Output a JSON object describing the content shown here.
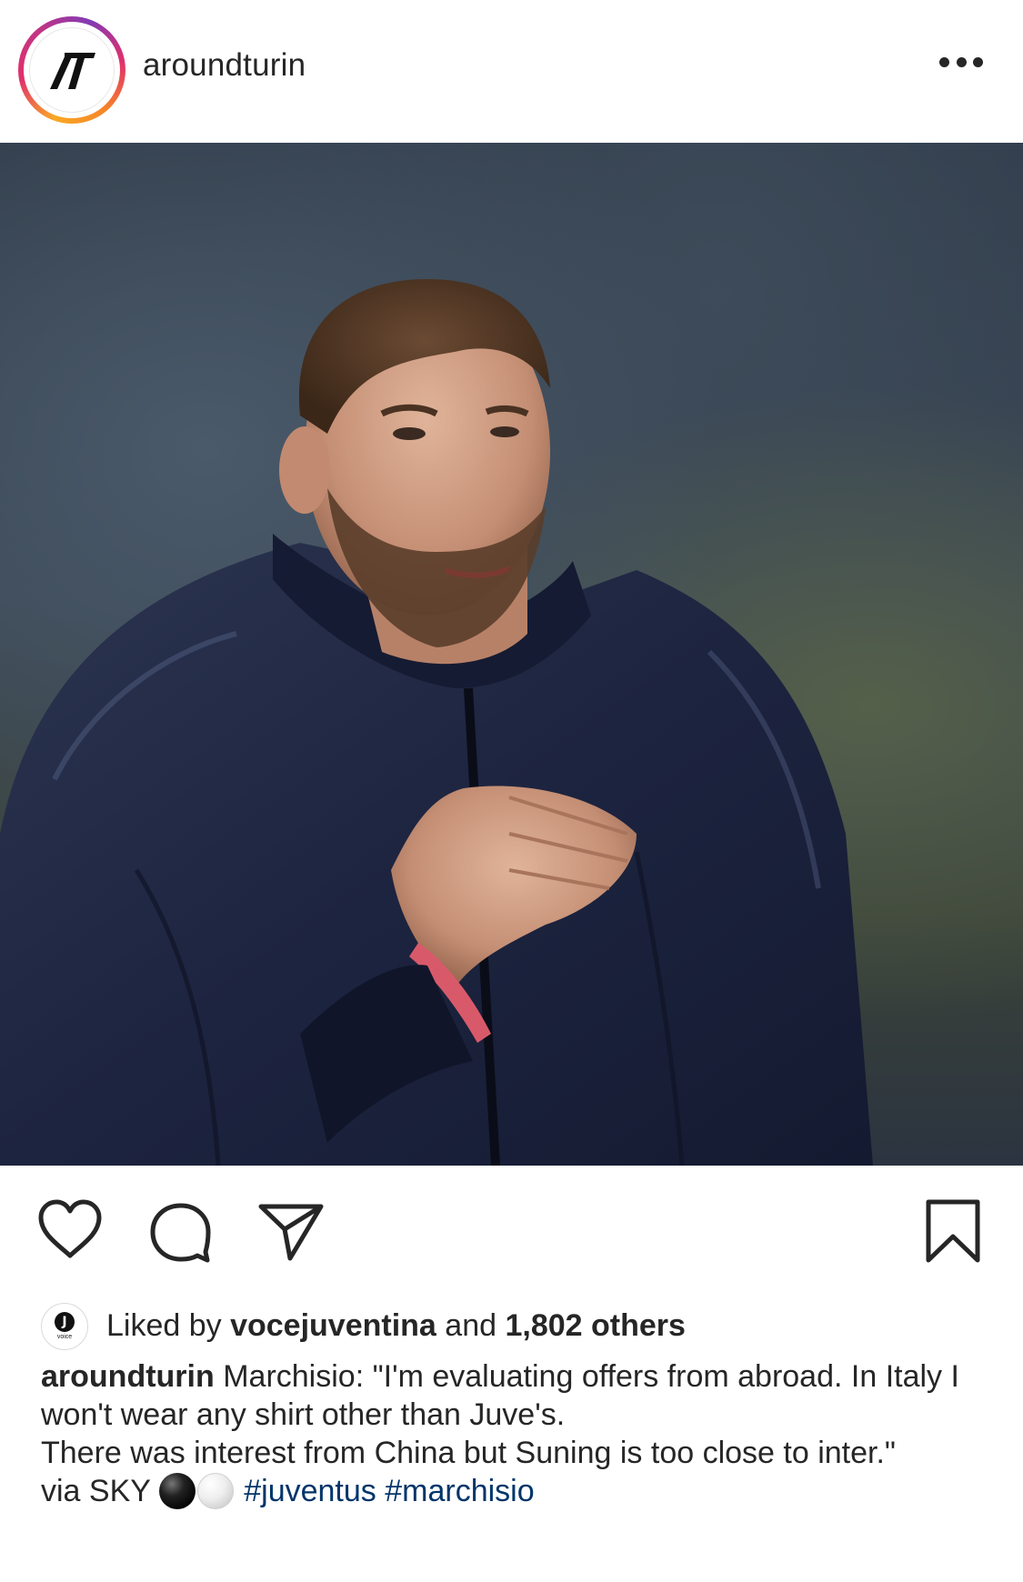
{
  "post": {
    "username": "aroundturin",
    "avatar_logo": "AT logo",
    "more_icon": "more-dots-icon"
  },
  "photo": {
    "description_icon": "post-photo"
  },
  "actions": {
    "like_icon": "heart-icon",
    "comment_icon": "comment-icon",
    "share_icon": "paper-plane-icon",
    "save_icon": "bookmark-icon"
  },
  "likes": {
    "prefix": "Liked by",
    "liker": "vocejuventina",
    "connector": "and",
    "others": "1,802 others",
    "liker_avatar_letter": "J",
    "liker_avatar_sub": "voice"
  },
  "caption": {
    "author": "aroundturin",
    "line1": "Marchisio: \"I'm evaluating offers from abroad. In Italy I won't wear any shirt other than Juve's.",
    "line2": "There was interest from China but Suning is too close to inter.\"",
    "via": "via SKY",
    "hashtag1": "#juventus",
    "hashtag2": "#marchisio"
  },
  "colors": {
    "text": "#262626",
    "hashtag": "#003569",
    "ring_gradient": [
      "#f9a825",
      "#e1306c",
      "#833ab4"
    ]
  }
}
